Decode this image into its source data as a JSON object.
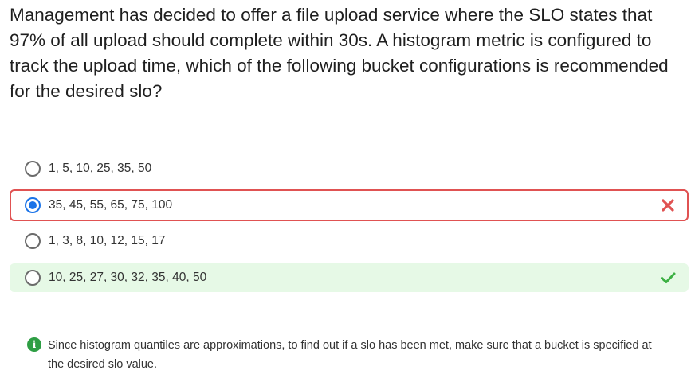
{
  "question": {
    "text": "Management has decided to offer a file upload service where the SLO states that 97% of all upload should complete within 30s. A histogram metric is configured to track the upload time, which of the following bucket configurations is recommended for the desired slo?"
  },
  "options": [
    {
      "label": "1, 5, 10, 25, 35, 50",
      "selected": false,
      "status": "none"
    },
    {
      "label": "35, 45, 55, 65, 75, 100",
      "selected": true,
      "status": "incorrect",
      "status_icon": "close-icon"
    },
    {
      "label": "1, 3, 8, 10, 12, 15, 17",
      "selected": false,
      "status": "none"
    },
    {
      "label": "10, 25, 27, 30, 32, 35, 40, 50",
      "selected": false,
      "status": "correct",
      "status_icon": "checkmark-icon"
    }
  ],
  "explanation": {
    "icon": "info-icon",
    "icon_glyph": "i",
    "text": "Since histogram quantiles are approximations, to find out if a slo has been met, make sure that a bucket is specified at the desired slo value."
  },
  "colors": {
    "selected_radio": "#1a73e8",
    "incorrect": "#e05252",
    "correct": "#3cb043",
    "correct_background": "#e6f9e6",
    "info": "#2e9e44"
  }
}
